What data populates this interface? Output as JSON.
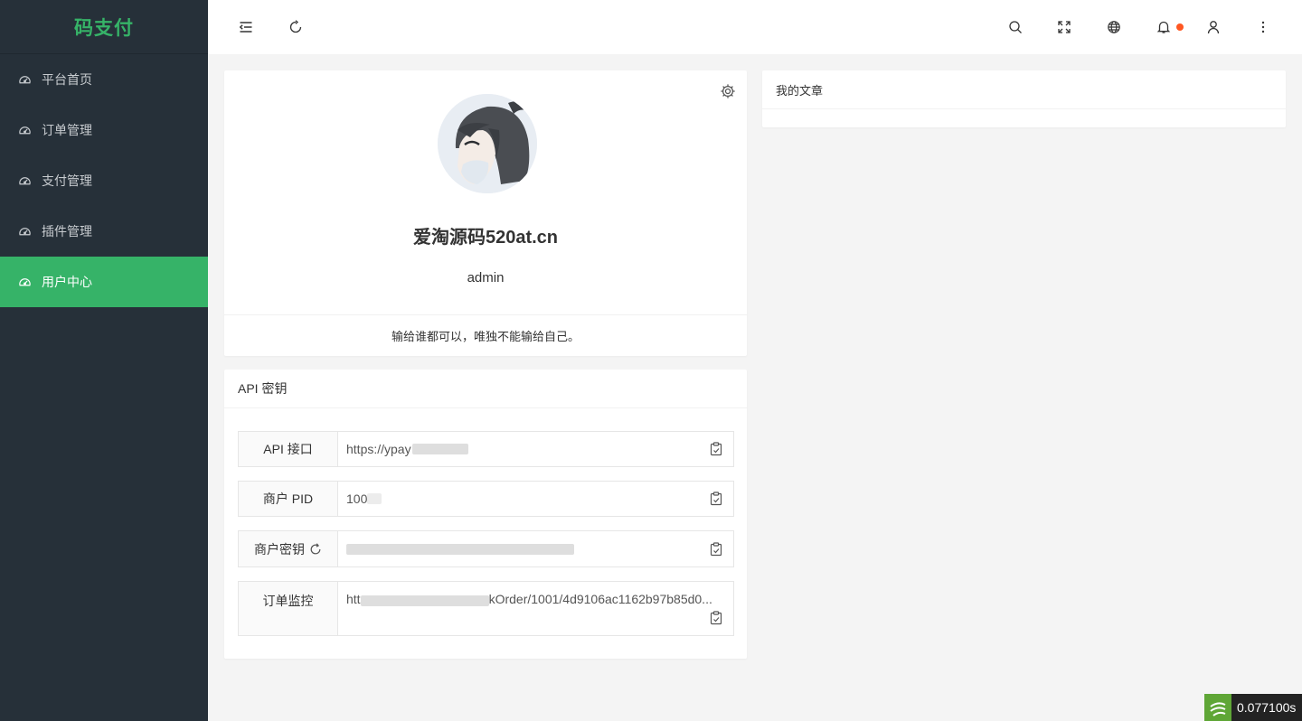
{
  "brand": {
    "name": "码支付",
    "color": "#36b368"
  },
  "sidebar": {
    "items": [
      {
        "label": "平台首页",
        "icon": "dashboard-icon",
        "active": false
      },
      {
        "label": "订单管理",
        "icon": "dashboard-icon",
        "active": false
      },
      {
        "label": "支付管理",
        "icon": "dashboard-icon",
        "active": false
      },
      {
        "label": "插件管理",
        "icon": "dashboard-icon",
        "active": false
      },
      {
        "label": "用户中心",
        "icon": "dashboard-icon",
        "active": true
      }
    ]
  },
  "header": {
    "icons": [
      "menu-toggle-icon",
      "refresh-icon",
      "search-icon",
      "fullscreen-icon",
      "globe-icon",
      "bell-icon",
      "user-icon",
      "more-icon"
    ],
    "notification_color": "#ff5722"
  },
  "profile": {
    "name": "爱淘源码520at.cn",
    "username": "admin",
    "motto": "输给谁都可以，唯独不能输给自己。"
  },
  "api": {
    "title": "API 密钥",
    "rows": [
      {
        "label": "API 接口",
        "value": "https://ypay"
      },
      {
        "label": "商户 PID",
        "value": "100"
      },
      {
        "label": "商户密钥",
        "value": ""
      },
      {
        "label": "订单监控",
        "value_prefix": "htt",
        "value_suffix": "kOrder/1001/4d9106ac1162b97b85d0..."
      }
    ]
  },
  "articles": {
    "title": "我的文章"
  },
  "timer": {
    "text": "0.077100s"
  }
}
